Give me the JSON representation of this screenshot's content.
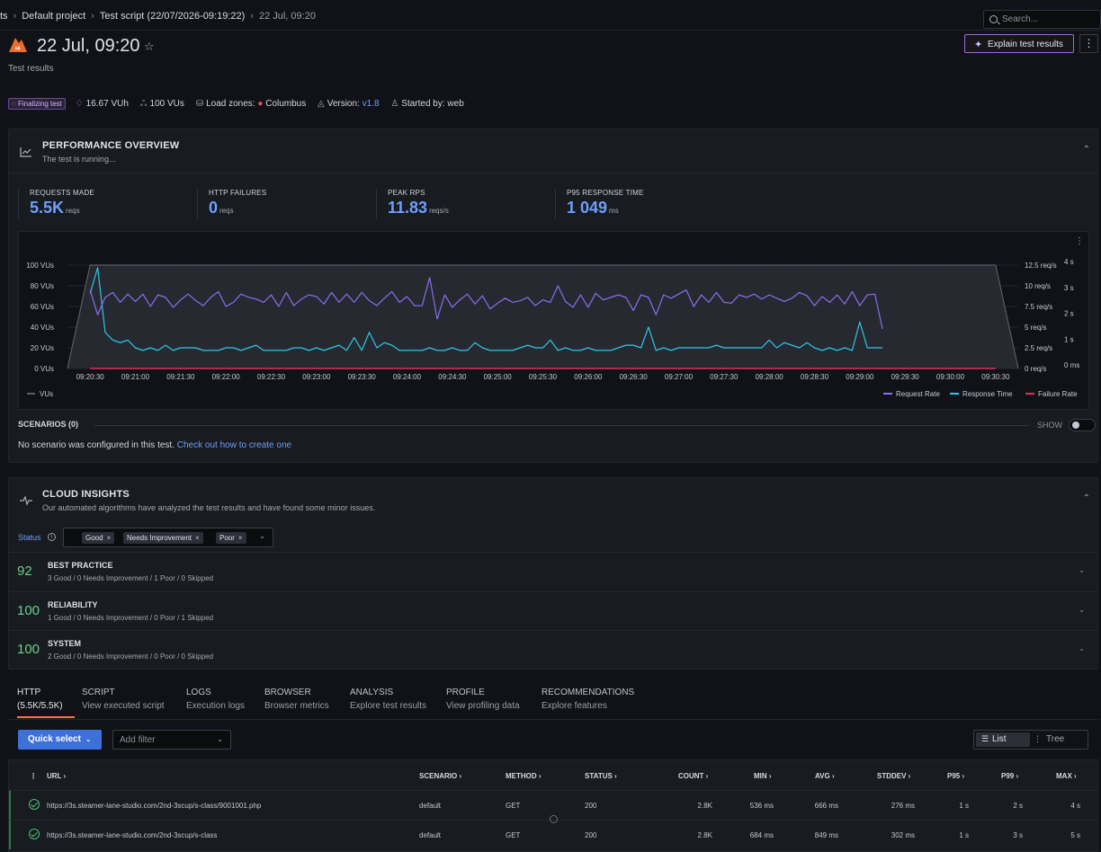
{
  "breadcrumb": {
    "items": [
      "ts",
      "Default project",
      "Test script (22/07/2026-09:19:22)",
      "22 Jul, 09:20"
    ],
    "separator": "›"
  },
  "search": {
    "placeholder": "Search..."
  },
  "header": {
    "title": "22 Jul, 09:20",
    "subtitle": "Test results",
    "explain_button": "Explain test results",
    "more": "⋮"
  },
  "meta": {
    "badge": "Finalizing test",
    "vuh": "16.67 VUh",
    "vus": "100 VUs",
    "load_zones_label": "Load zones:",
    "load_zone": "Columbus",
    "version_label": "Version:",
    "version": "v1.8",
    "started_label": "Started by:",
    "started_by": "web"
  },
  "performance": {
    "title": "PERFORMANCE OVERVIEW",
    "subtitle": "The test is running...",
    "stats": [
      {
        "label": "REQUESTS MADE",
        "value": "5.5K",
        "unit": "reqs"
      },
      {
        "label": "HTTP FAILURES",
        "value": "0",
        "unit": "reqs"
      },
      {
        "label": "PEAK RPS",
        "value": "11.83",
        "unit": "reqs/s"
      },
      {
        "label": "P95 RESPONSE TIME",
        "value": "1 049",
        "unit": "ms"
      }
    ],
    "scenarios_label": "SCENARIOS (0)",
    "show_label": "SHOW",
    "no_scenario_text": "No scenario was configured in this test.",
    "no_scenario_link": "Check out how to create one"
  },
  "chart_data": {
    "type": "line",
    "x_ticks": [
      "09:20:30",
      "09:21:00",
      "09:21:30",
      "09:22:00",
      "09:22:30",
      "09:23:00",
      "09:23:30",
      "09:24:00",
      "09:24:30",
      "09:25:00",
      "09:25:30",
      "09:26:00",
      "09:26:30",
      "09:27:00",
      "09:27:30",
      "09:28:00",
      "09:28:30",
      "09:29:00",
      "09:29:30",
      "09:30:00",
      "09:30:30"
    ],
    "y_left_ticks": [
      "100 VUs",
      "80 VUs",
      "60 VUs",
      "40 VUs",
      "20 VUs",
      "0 VUs"
    ],
    "y_mid_ticks": [
      "12.5 req/s",
      "10 req/s",
      "7.5 req/s",
      "5 req/s",
      "2.5 req/s",
      "0 req/s"
    ],
    "y_right_ticks": [
      "4 s",
      "3 s",
      "2 s",
      "1 s",
      "0 ms"
    ],
    "legend_left": [
      "VUs"
    ],
    "legend_right": [
      "Request Rate",
      "Response Time",
      "Failure Rate"
    ],
    "colors": {
      "vus": "#5a5c66",
      "request_rate": "#8c6cf0",
      "response_time": "#2ec6e8",
      "failure_rate": "#e02f5e"
    },
    "x_range": [
      "09:20:15",
      "09:30:45"
    ],
    "vus": {
      "unit": "VUs",
      "x": [
        "09:20:15",
        "09:20:30",
        "09:30:30",
        "09:30:45"
      ],
      "y": [
        0,
        100,
        100,
        0
      ]
    },
    "request_rate": {
      "unit": "req/s",
      "start": "09:20:30",
      "step_seconds": 5,
      "y": [
        9.5,
        6.5,
        8.6,
        9.2,
        8.0,
        9.0,
        8.1,
        9.0,
        7.5,
        8.9,
        8.6,
        7.4,
        8.3,
        9.0,
        8.2,
        7.6,
        8.6,
        9.3,
        7.5,
        8.0,
        9.0,
        8.6,
        8.4,
        8.0,
        8.9,
        7.5,
        9.2,
        7.6,
        8.4,
        8.9,
        8.7,
        7.8,
        9.2,
        8.0,
        9.0,
        8.0,
        9.2,
        8.2,
        7.6,
        8.5,
        9.3,
        8.0,
        8.7,
        7.6,
        7.6,
        11.0,
        6.0,
        8.9,
        7.4,
        8.3,
        9.0,
        7.8,
        8.8,
        7.2,
        7.9,
        8.5,
        8.0,
        8.2,
        8.6,
        7.6,
        8.3,
        8.0,
        10.0,
        8.1,
        7.4,
        8.9,
        7.4,
        9.1,
        8.3,
        8.6,
        8.9,
        8.6,
        7.0,
        8.9,
        8.6,
        6.5,
        8.9,
        8.5,
        9.0,
        9.5,
        7.5,
        8.9,
        8.0,
        9.2,
        8.0,
        7.9,
        8.9,
        8.6,
        9.0,
        8.4,
        8.9,
        8.5,
        8.1,
        8.5,
        9.2,
        8.8,
        7.6,
        8.7,
        8.0,
        8.9,
        7.8,
        9.3,
        7.6,
        8.9,
        9.0,
        4.8
      ]
    },
    "response_time": {
      "unit": "s",
      "start": "09:20:30",
      "step_seconds": 5,
      "y": [
        2.9,
        3.9,
        1.4,
        1.1,
        1.0,
        1.1,
        0.8,
        0.7,
        0.8,
        0.7,
        0.9,
        0.7,
        0.8,
        0.8,
        0.8,
        0.7,
        0.7,
        0.7,
        0.8,
        0.8,
        0.7,
        0.8,
        0.9,
        0.7,
        0.7,
        0.7,
        0.7,
        0.8,
        0.8,
        0.7,
        0.8,
        0.7,
        0.8,
        0.9,
        0.7,
        1.2,
        0.7,
        1.4,
        0.8,
        1.0,
        0.9,
        0.7,
        0.7,
        0.7,
        0.7,
        0.8,
        0.7,
        0.7,
        0.8,
        0.7,
        0.7,
        1.0,
        0.8,
        0.7,
        0.7,
        0.7,
        0.7,
        0.8,
        0.9,
        0.8,
        0.8,
        1.1,
        0.7,
        0.8,
        0.7,
        0.7,
        0.8,
        0.7,
        0.7,
        0.7,
        0.8,
        0.9,
        0.9,
        0.8,
        1.6,
        0.7,
        0.8,
        0.7,
        0.8,
        0.8,
        0.8,
        0.8,
        0.8,
        0.9,
        0.8,
        0.8,
        0.8,
        0.8,
        0.8,
        0.8,
        1.1,
        0.8,
        1.0,
        0.9,
        0.8,
        1.0,
        0.8,
        0.7,
        0.8,
        0.7,
        0.8,
        0.7,
        1.8,
        0.8,
        0.8,
        0.8
      ]
    },
    "failure_rate": {
      "unit": "req/s",
      "x": [
        "09:20:30",
        "09:30:30"
      ],
      "y": [
        0,
        0
      ]
    },
    "grid": true,
    "legend_placement": "bottom"
  },
  "insights": {
    "title": "CLOUD INSIGHTS",
    "subtitle": "Our automated algorithms have analyzed the test results and have found some minor issues.",
    "status_label": "Status",
    "tags": [
      "Good",
      "Needs Improvement",
      "Poor"
    ],
    "rows": [
      {
        "score": "92",
        "name": "BEST PRACTICE",
        "detail": "3 Good / 0 Needs Improvement / 1 Poor / 0 Skipped"
      },
      {
        "score": "100",
        "name": "RELIABILITY",
        "detail": "1 Good / 0 Needs Improvement / 0 Poor / 1 Skipped"
      },
      {
        "score": "100",
        "name": "SYSTEM",
        "detail": "2 Good / 0 Needs Improvement / 0 Poor / 0 Skipped"
      }
    ]
  },
  "tabs": [
    {
      "label": "HTTP",
      "sub": "(5.5K/5.5K)"
    },
    {
      "label": "SCRIPT",
      "sub": "View executed script"
    },
    {
      "label": "LOGS",
      "sub": "Execution logs"
    },
    {
      "label": "BROWSER",
      "sub": "Browser metrics"
    },
    {
      "label": "ANALYSIS",
      "sub": "Explore test results"
    },
    {
      "label": "PROFILE",
      "sub": "View profiling data"
    },
    {
      "label": "RECOMMENDATIONS",
      "sub": "Explore features"
    }
  ],
  "toolbar": {
    "quick_select": "Quick select",
    "add_filter": "Add filter",
    "list": "List",
    "tree": "Tree"
  },
  "table": {
    "headers": [
      "URL ›",
      "SCENARIO ›",
      "METHOD ›",
      "STATUS ›",
      "COUNT ›",
      "MIN ›",
      "AVG ›",
      "STDDEV ›",
      "P95 ›",
      "P99 ›",
      "MAX ›"
    ],
    "rows": [
      [
        "https://3s.steamer-lane-studio.com/2nd-3scup/s-class/9001001.php",
        "default",
        "GET",
        "200",
        "2.8K",
        "536 ms",
        "666 ms",
        "276 ms",
        "1 s",
        "2 s",
        "4 s"
      ],
      [
        "https://3s.steamer-lane-studio.com/2nd-3scup/s-class",
        "default",
        "GET",
        "200",
        "2.8K",
        "684 ms",
        "849 ms",
        "302 ms",
        "1 s",
        "3 s",
        "5 s"
      ]
    ]
  }
}
